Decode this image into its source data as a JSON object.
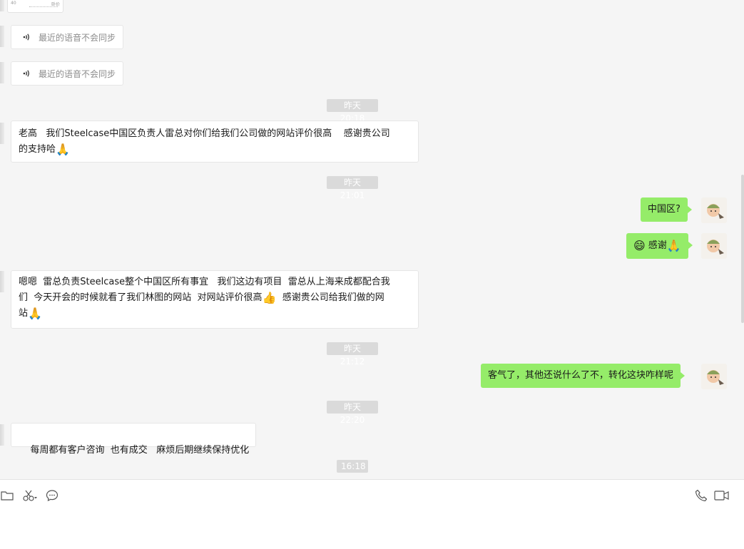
{
  "chat": {
    "top_card": {
      "left_text": "40",
      "right_text": "卧价"
    },
    "voice_messages": [
      {
        "text": "最近的语音不会同步"
      },
      {
        "text": "最近的语音不会同步"
      }
    ],
    "timestamps": [
      "昨天 20:18",
      "昨天 21:01",
      "昨天 21:12",
      "昨天 22:20",
      "16:18"
    ],
    "messages": [
      {
        "side": "in",
        "lines": [
          "老高   我们Steelcase中国区负责人雷总对你们给我们公司做的网站评价很高    感谢贵公司",
          "的支持哈"
        ],
        "emoji_end": "🙏"
      },
      {
        "side": "out",
        "text": "中国区?"
      },
      {
        "side": "out",
        "emoji_start": "😄",
        "text": "感谢",
        "emoji_end": "🙏"
      },
      {
        "side": "in",
        "lines": [
          "嗯嗯  雷总负责Steelcase整个中国区所有事宜   我们这边有项目  雷总从上海来成都配合我",
          "们  今天开会的时候就看了我们林图的网站  对网站评价很高",
          "站"
        ],
        "emoji_mid": "👍",
        "line2_tail": "  感谢贵公司给我们做的网",
        "emoji_end": "🙏"
      },
      {
        "side": "out",
        "text": "客气了，其他还说什么了不，转化这块咋样呢"
      },
      {
        "side": "in",
        "lines": [
          "每周都有客户咨询  也有成交   麻烦后期继续保持优化"
        ]
      }
    ]
  },
  "toolbar": {
    "left_icons": [
      "folder-icon",
      "scissors-icon",
      "chat-bubble-icon"
    ],
    "right_icons": [
      "phone-icon",
      "video-call-icon"
    ]
  },
  "colors": {
    "outgoing_bubble": "#95ec69",
    "incoming_bubble": "#ffffff",
    "timestamp_bg": "#dadada",
    "background": "#f5f5f5"
  }
}
